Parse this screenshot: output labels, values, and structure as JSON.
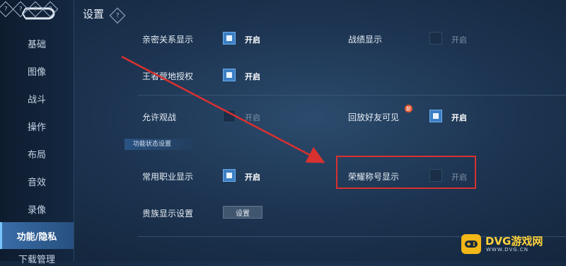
{
  "page": {
    "title": "设置",
    "title_help_icon": "help-diamond-icon"
  },
  "sidebar": {
    "back_icon": "back-arrow-icon",
    "items": [
      {
        "label": "基础",
        "active": false
      },
      {
        "label": "图像",
        "active": false
      },
      {
        "label": "战斗",
        "active": false
      },
      {
        "label": "操作",
        "active": false
      },
      {
        "label": "布局",
        "active": false
      },
      {
        "label": "音效",
        "active": false
      },
      {
        "label": "录像",
        "active": false
      },
      {
        "label": "功能/隐私",
        "active": true
      },
      {
        "label": "下载管理",
        "active": false
      }
    ]
  },
  "settings": {
    "intimacy": {
      "label": "亲密关系显示",
      "checked": true,
      "state": "开启"
    },
    "record": {
      "label": "战绩显示",
      "checked": false,
      "state": "开启"
    },
    "camp_auth": {
      "label": "王者营地授权",
      "checked": true,
      "state": "开启"
    },
    "allow_watch": {
      "label": "允许观战",
      "checked": false,
      "state": "开启"
    },
    "replay_friends": {
      "label": "回放好友可见",
      "checked": true,
      "state": "开启",
      "badge": "新"
    },
    "section_title": "功能状态设置",
    "common_job": {
      "label": "常用职业显示",
      "checked": true,
      "state": "开启"
    },
    "honor_title": {
      "label": "荣耀称号显示",
      "checked": false,
      "state": "开启"
    },
    "noble": {
      "label": "贵族显示设置",
      "button": "设置"
    }
  },
  "watermark": {
    "name": "DVG游戏网",
    "url": "WWW.DVG.CN",
    "icon": "gamepad-icon"
  },
  "colors": {
    "accent": "#3d7fc4",
    "highlight": "#d8312f",
    "arrow": "#d8312f"
  }
}
